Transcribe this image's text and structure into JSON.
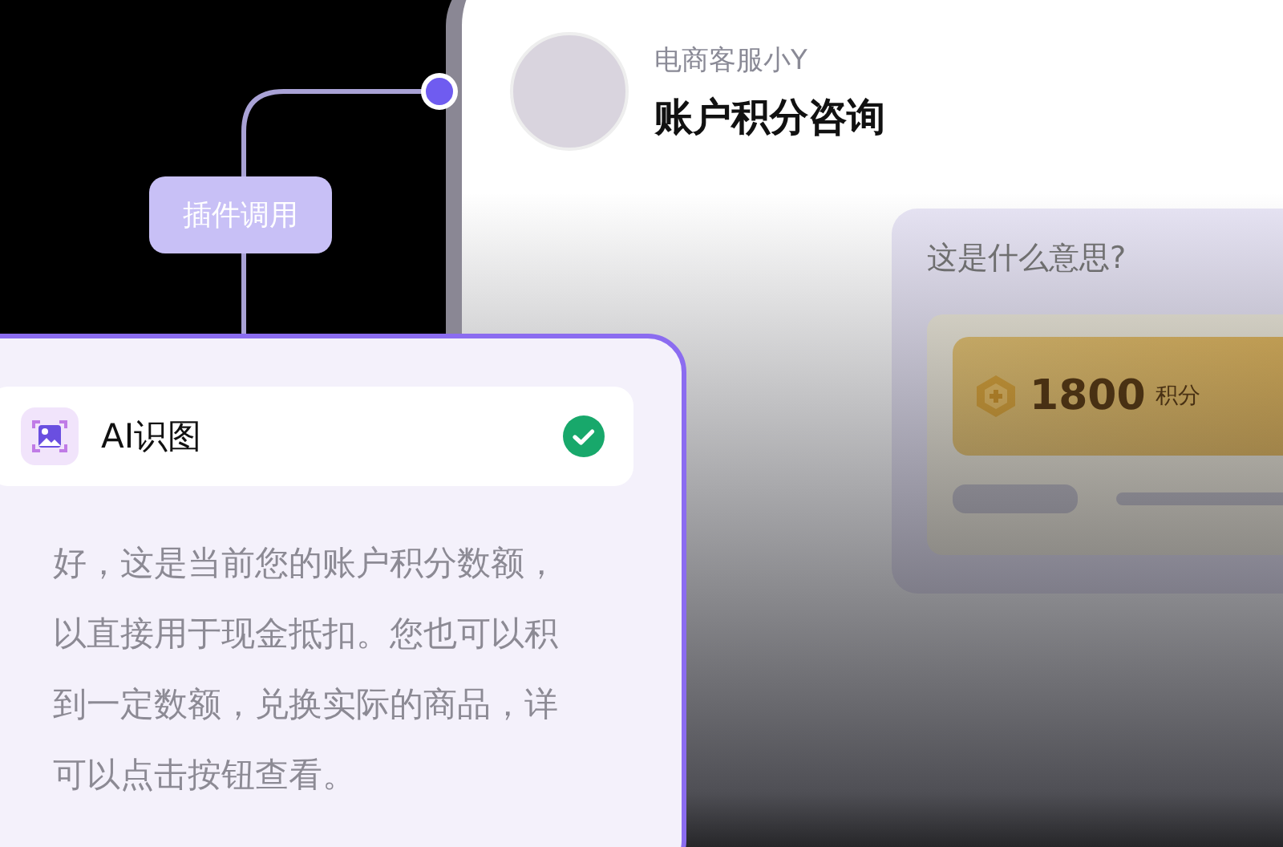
{
  "flow": {
    "step_label": "插件调用"
  },
  "chat": {
    "agent_name": "电商客服小Y",
    "topic": "账户积分咨询",
    "user_message": "这是什么意思?",
    "points_card": {
      "amount": "1800",
      "unit": "积分"
    }
  },
  "tool_card": {
    "title": "AI识图",
    "completed": true,
    "lines": [
      "好，这是当前您的账户积分数额，",
      "以直接用于现金抵扣。您也可以积",
      "到一定数额，兑换实际的商品，详",
      "可以点击按钮查看。"
    ]
  }
}
